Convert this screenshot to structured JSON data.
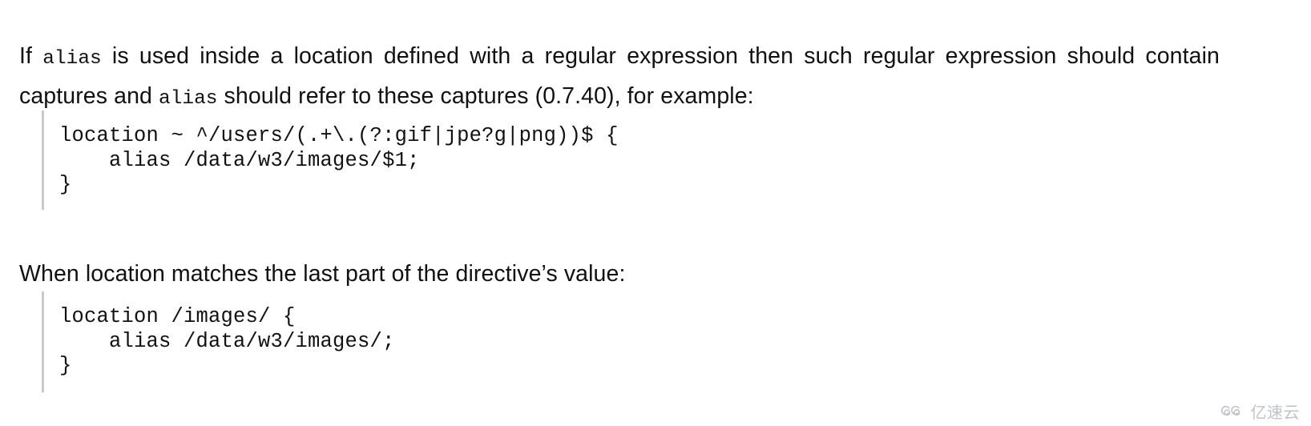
{
  "document": {
    "paragraph_1": {
      "segment_1": "If ",
      "code_1": "alias",
      "segment_2": " is used inside a location defined with a regular expression then such regular expression should contain captures and ",
      "code_2": "alias",
      "segment_3": " should refer to these captures (0.7.40), for example:"
    },
    "code_block_1": {
      "lines": [
        "location ~ ^/users/(.+\\.(?:gif|jpe?g|png))$ {",
        "    alias /data/w3/images/$1;",
        "}"
      ]
    },
    "paragraph_2": {
      "text": "When location matches the last part of the directive’s value:"
    },
    "code_block_2": {
      "lines": [
        "location /images/ {",
        "    alias /data/w3/images/;",
        "}"
      ]
    }
  },
  "watermark": {
    "text": "亿速云",
    "logo_icon": "cloud-spiral-logo-icon",
    "color": "#a6adb4"
  },
  "colors": {
    "page_background": "#ffffff",
    "body_text": "#111111",
    "code_border": "#c9c9c9",
    "watermark": "#a6adb4"
  }
}
